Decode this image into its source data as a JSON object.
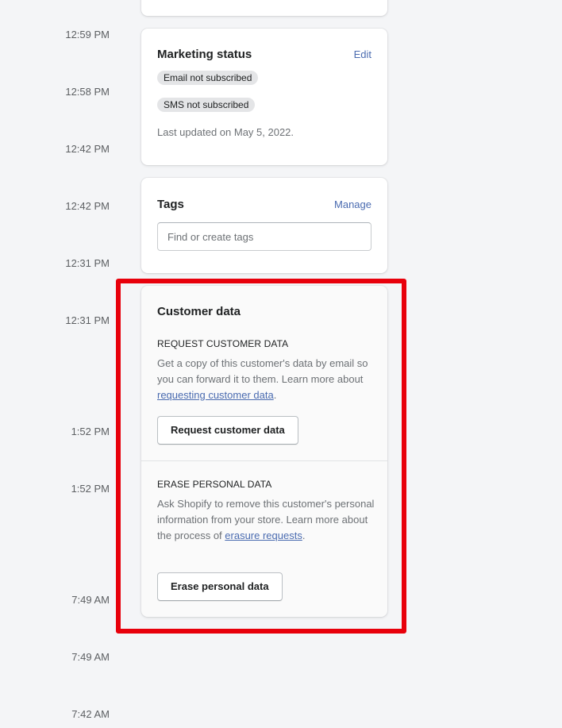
{
  "timeline": {
    "times": [
      "12:59 PM",
      "12:58 PM",
      "12:42 PM",
      "12:42 PM",
      "12:31 PM",
      "12:31 PM",
      "1:52 PM",
      "1:52 PM",
      "7:49 AM",
      "7:49 AM",
      "7:42 AM"
    ]
  },
  "marketing": {
    "title": "Marketing status",
    "edit_label": "Edit",
    "email_badge": "Email not subscribed",
    "sms_badge": "SMS not subscribed",
    "last_updated": "Last updated on May 5, 2022."
  },
  "tags": {
    "title": "Tags",
    "manage_label": "Manage",
    "input_placeholder": "Find or create tags"
  },
  "customer_data": {
    "title": "Customer data",
    "request": {
      "heading": "REQUEST CUSTOMER DATA",
      "desc_before": "Get a copy of this customer's data by email so you can forward it to them. Learn more about ",
      "link": "requesting customer data",
      "desc_after": ".",
      "button": "Request customer data"
    },
    "erase": {
      "heading": "ERASE PERSONAL DATA",
      "desc_before": "Ask Shopify to remove this customer's personal information from your store. Learn more about the process of ",
      "link": "erasure requests",
      "desc_after": ".",
      "button": "Erase personal data"
    }
  },
  "colors": {
    "highlight": "#e8000b",
    "link": "#4a6bb0",
    "background": "#f4f5f7"
  }
}
